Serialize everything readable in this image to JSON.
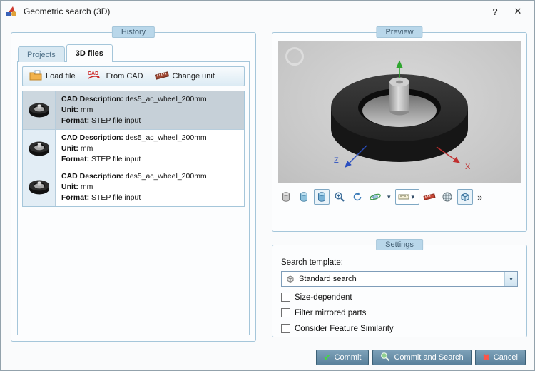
{
  "window": {
    "title": "Geometric search (3D)",
    "help_label": "?",
    "close_glyph": "✕"
  },
  "history": {
    "group_label": "History",
    "tabs": [
      {
        "label": "Projects",
        "active": false
      },
      {
        "label": "3D files",
        "active": true
      }
    ],
    "toolbar": {
      "load_file": "Load file",
      "from_cad": "From CAD",
      "change_unit": "Change unit",
      "cad_icon_text": "CAD"
    },
    "items": [
      {
        "selected": true,
        "fields": [
          {
            "label": "CAD Description:",
            "value": "des5_ac_wheel_200mm"
          },
          {
            "label": "Unit:",
            "value": "mm"
          },
          {
            "label": "Format:",
            "value": "STEP file input"
          }
        ]
      },
      {
        "selected": false,
        "fields": [
          {
            "label": "CAD Description:",
            "value": "des5_ac_wheel_200mm"
          },
          {
            "label": "Unit:",
            "value": "mm"
          },
          {
            "label": "Format:",
            "value": "STEP file input"
          }
        ]
      },
      {
        "selected": false,
        "fields": [
          {
            "label": "CAD Description:",
            "value": "des5_ac_wheel_200mm"
          },
          {
            "label": "Unit:",
            "value": "mm"
          },
          {
            "label": "Format:",
            "value": "STEP file input"
          }
        ]
      }
    ]
  },
  "preview": {
    "group_label": "Preview",
    "axes": {
      "z": "Z",
      "x": "X"
    },
    "toolbar_icons": [
      "cylinder-gray",
      "cylinder-teal",
      "cylinder-active",
      "zoom-in",
      "fit-view",
      "rotate-view",
      "measure-dropdown",
      "ruler-red",
      "mesh-sphere",
      "clip-box"
    ],
    "dropdown_glyph": "▾",
    "overflow_glyph": "»",
    "colors": {
      "axis_x": "#c03030",
      "axis_z": "#2b4fc0",
      "axis_y": "#2fa52f"
    }
  },
  "settings": {
    "group_label": "Settings",
    "search_template_label": "Search template:",
    "search_template_value": "Standard search",
    "dropdown_glyph": "▾",
    "checkboxes": [
      {
        "label": "Size-dependent",
        "checked": false
      },
      {
        "label": "Filter mirrored parts",
        "checked": false
      },
      {
        "label": "Consider Feature Similarity",
        "checked": false
      }
    ]
  },
  "footer": {
    "commit_label": "Commit",
    "commit_icon_glyph": "✔",
    "commit_and_search_label": "Commit and Search",
    "cancel_label": "Cancel",
    "cancel_icon_glyph": "✖"
  }
}
